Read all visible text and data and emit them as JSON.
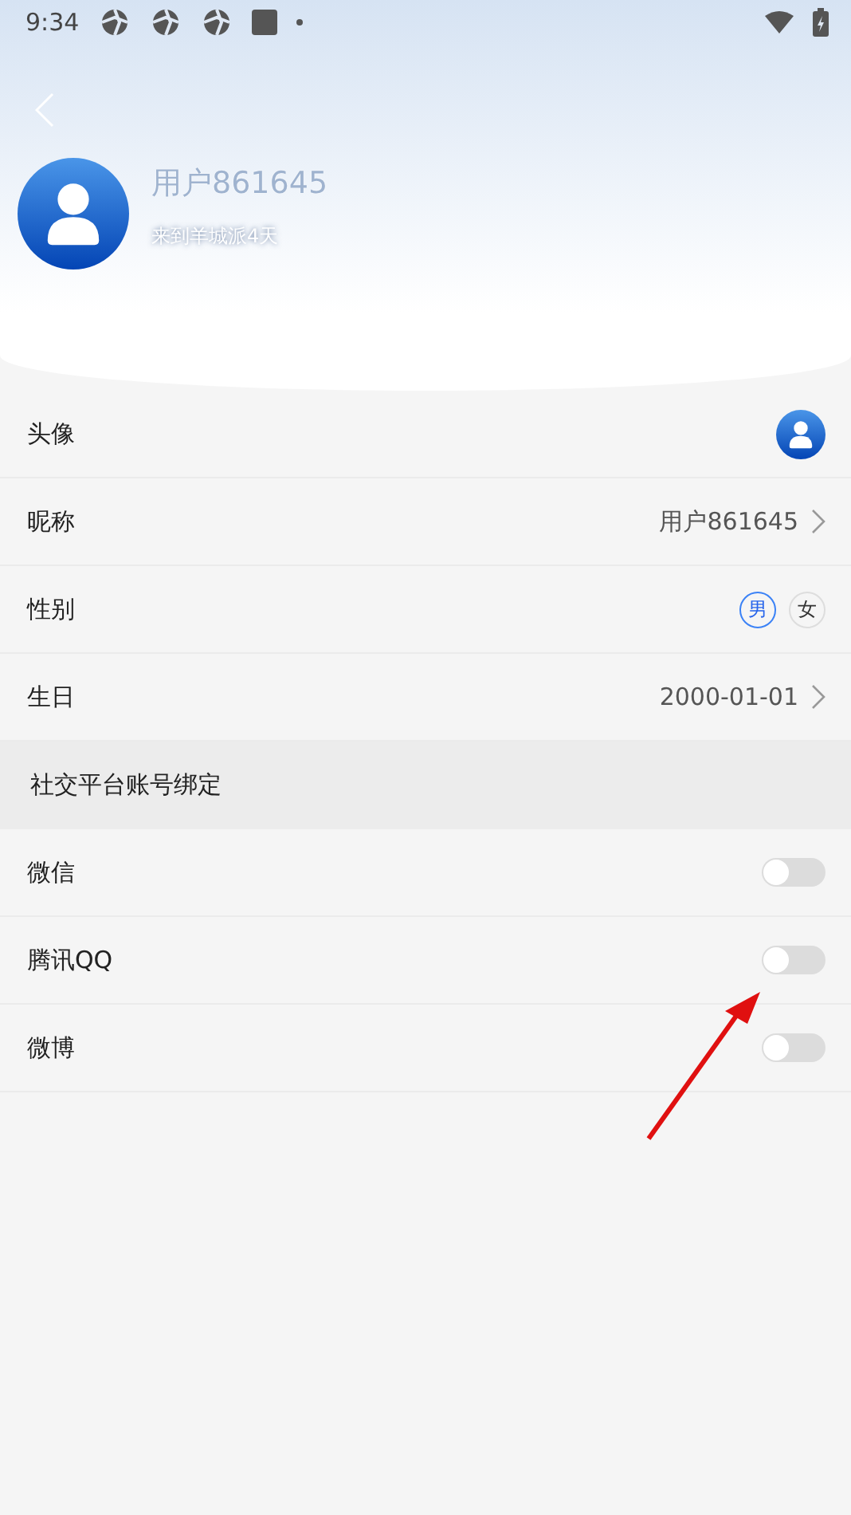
{
  "status_bar": {
    "time": "9:34"
  },
  "profile": {
    "name": "用户861645",
    "days": "来到羊城派4天"
  },
  "rows": [
    {
      "kind": "avatar",
      "label": "头像"
    },
    {
      "kind": "link",
      "label": "昵称",
      "value": "用户861645"
    },
    {
      "kind": "gender",
      "label": "性别",
      "options": [
        {
          "label": "男",
          "selected": true
        },
        {
          "label": "女",
          "selected": false
        }
      ]
    },
    {
      "kind": "link",
      "label": "生日",
      "value": "2000-01-01"
    }
  ],
  "binding": {
    "title": "社交平台账号绑定",
    "items": [
      {
        "label": "微信",
        "on": false
      },
      {
        "label": "腾讯QQ",
        "on": false
      },
      {
        "label": "微博",
        "on": false
      }
    ]
  }
}
